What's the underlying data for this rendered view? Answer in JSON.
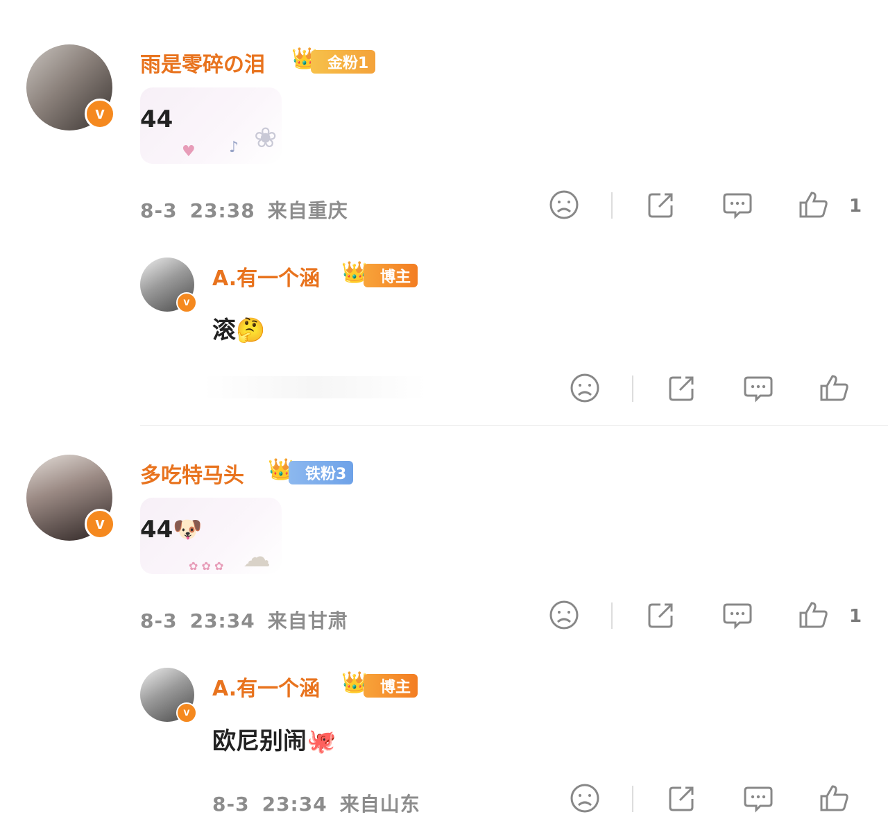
{
  "comments": [
    {
      "name": "雨是零碎の泪",
      "crown": "👑",
      "tag": "金粉1",
      "content": "44",
      "date": "8-3",
      "time": "23:38",
      "location": "来自重庆",
      "likes": "1",
      "reply": {
        "name": "A.有一个涵",
        "crown": "👑",
        "tag": "博主",
        "content": "滚",
        "emoji": "🤔"
      }
    },
    {
      "name": "多吃特马头",
      "crown": "👑",
      "tag": "铁粉3",
      "content": "44",
      "emoji": "🐶",
      "date": "8-3",
      "time": "23:34",
      "location": "来自甘肃",
      "likes": "1",
      "reply": {
        "name": "A.有一个涵",
        "crown": "👑",
        "tag": "博主",
        "content": "欧尼别闹",
        "emoji": "🐙",
        "date": "8-3",
        "time": "23:34",
        "location": "来自山东"
      }
    }
  ],
  "badges": {
    "verified": "v"
  },
  "colors": {
    "name": "#e8731e",
    "meta": "#8c8c8c",
    "badge": "#f5891f"
  },
  "icons": [
    "dislike-icon",
    "share-icon",
    "comment-icon",
    "like-icon"
  ]
}
